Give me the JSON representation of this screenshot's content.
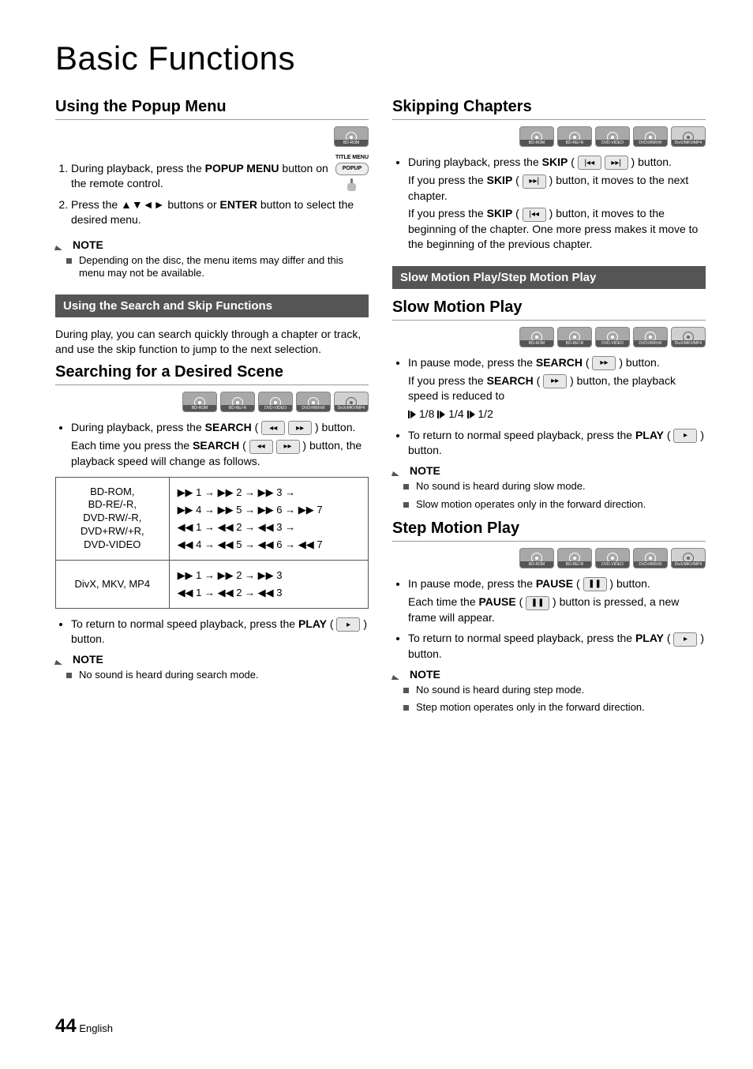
{
  "pageTitle": "Basic Functions",
  "pageNumber": "44",
  "pageLang": "English",
  "discLabels": [
    "BD-ROM",
    "BD-RE/-R",
    "DVD-VIDEO",
    "DVD±RW/±R",
    "DivX/MKV/MP4"
  ],
  "left": {
    "popupMenu": {
      "heading": "Using the Popup Menu",
      "remoteTitle": "TITLE MENU",
      "remotePopup": "POPUP",
      "step1a": "During playback, press the ",
      "step1b": "POPUP MENU",
      "step1c": " button on the remote control.",
      "step2a": "Press the ",
      "step2b": " buttons or ",
      "step2c": "ENTER",
      "step2d": " button to select the desired menu.",
      "noteLabel": "NOTE",
      "note1": "Depending on the disc, the menu items may differ and this menu may not be available."
    },
    "bar1": "Using the Search and Skip Functions",
    "searchIntro": "During play, you can search quickly through a chapter or track, and use the skip function to jump to the next selection.",
    "searching": {
      "heading": "Searching for a Desired Scene",
      "b1a": "During playback, press the ",
      "b1b": "SEARCH",
      "b1c": " button.",
      "sub1a": "Each time you press the ",
      "sub1b": "SEARCH",
      "sub1c": " button, the playback speed will change as follows.",
      "row1Label": "BD-ROM,\nBD-RE/-R,\nDVD-RW/-R,\nDVD+RW/+R,\nDVD-VIDEO",
      "row1Seq": "▶▶ 1 → ▶▶ 2 → ▶▶ 3 →\n▶▶ 4 → ▶▶ 5 → ▶▶ 6 → ▶▶ 7\n◀◀ 1 → ◀◀ 2 → ◀◀ 3 →\n◀◀ 4 → ◀◀ 5 → ◀◀ 6 → ◀◀ 7",
      "row2Label": "DivX, MKV, MP4",
      "row2Seq": "▶▶ 1 → ▶▶ 2 → ▶▶ 3\n◀◀ 1 → ◀◀ 2 → ◀◀ 3",
      "ret1a": "To return to normal speed playback, press the ",
      "ret1b": "PLAY",
      "ret1c": " button.",
      "noteLabel": "NOTE",
      "note1": "No sound is heard during search mode."
    }
  },
  "right": {
    "skip": {
      "heading": "Skipping Chapters",
      "b1a": "During playback, press the ",
      "b1b": "SKIP",
      "b1c": " button.",
      "s1a": "If you press the ",
      "s1b": "SKIP",
      "s1c": " button, it moves to the next chapter.",
      "s2a": "If you press the ",
      "s2b": "SKIP",
      "s2c": " button, it moves to the beginning of the chapter. One more press makes it move to the beginning of the previous chapter."
    },
    "bar1": "Slow Motion Play/Step Motion Play",
    "slow": {
      "heading": "Slow Motion Play",
      "b1a": "In pause mode, press the ",
      "b1b": "SEARCH",
      "b1c": " button.",
      "s1a": "If you press the ",
      "s1b": "SEARCH",
      "s1c": " button, the playback speed is reduced to",
      "speed1": "1/8",
      "speed2": "1/4",
      "speed3": "1/2",
      "ret1a": "To return to normal speed playback, press the ",
      "ret1b": "PLAY",
      "ret1c": " button.",
      "noteLabel": "NOTE",
      "note1": "No sound is heard during slow mode.",
      "note2": "Slow motion operates only in the forward direction."
    },
    "step": {
      "heading": "Step Motion Play",
      "b1a": "In pause mode, press the ",
      "b1b": "PAUSE",
      "b1c": " button.",
      "s1a": "Each time the ",
      "s1b": "PAUSE",
      "s1c": " button is pressed, a new frame will appear.",
      "ret1a": "To return to normal speed playback, press the ",
      "ret1b": "PLAY",
      "ret1c": " button.",
      "noteLabel": "NOTE",
      "note1": "No sound is heard during step mode.",
      "note2": "Step motion operates only in the forward direction."
    }
  }
}
